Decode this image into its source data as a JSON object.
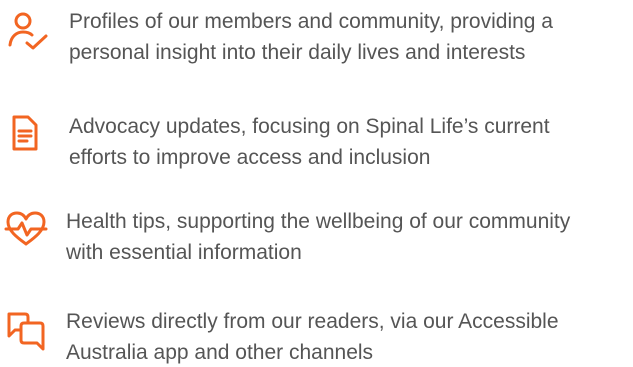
{
  "accent_color": "#f26522",
  "text_color": "#555555",
  "features": [
    {
      "icon": "person-check-icon",
      "lines": [
        "Profiles of our members and community, providing a",
        "personal insight into their daily lives and interests"
      ]
    },
    {
      "icon": "document-icon",
      "lines": [
        "Advocacy updates, focusing on Spinal Life’s current",
        "efforts to improve access and inclusion"
      ]
    },
    {
      "icon": "heart-pulse-icon",
      "lines": [
        "Health tips, supporting the wellbeing of our community",
        "with essential information"
      ]
    },
    {
      "icon": "speech-bubbles-icon",
      "lines": [
        "Reviews directly from our readers, via our Accessible",
        "Australia app and other channels"
      ]
    }
  ]
}
